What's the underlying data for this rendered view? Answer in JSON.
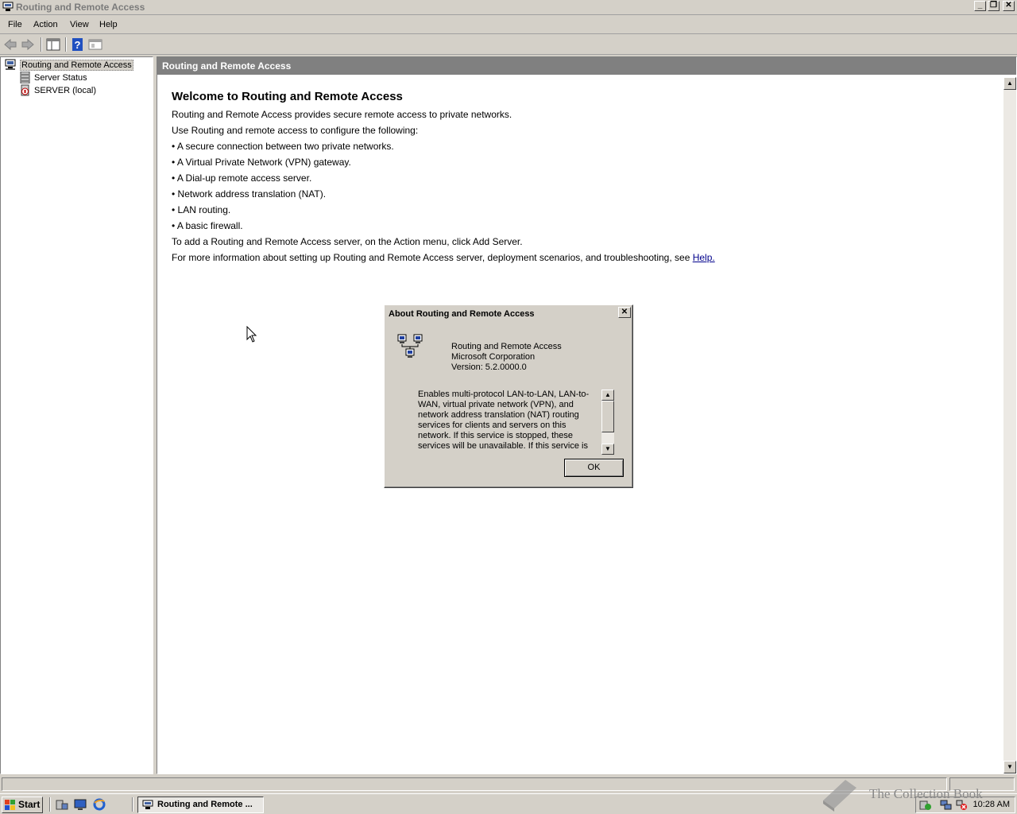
{
  "window": {
    "title": "Routing and Remote Access"
  },
  "menu": {
    "file": "File",
    "action": "Action",
    "view": "View",
    "help": "Help"
  },
  "tree": {
    "root": "Routing and Remote Access",
    "items": [
      {
        "label": "Server Status"
      },
      {
        "label": "SERVER (local)"
      }
    ]
  },
  "content": {
    "header": "Routing and Remote Access",
    "title": "Welcome to Routing and Remote Access",
    "lines": [
      "Routing and Remote Access provides secure remote access to private networks.",
      "Use Routing and remote access to configure the following:",
      "• A secure connection between two private networks.",
      "• A Virtual Private Network (VPN) gateway.",
      "• A Dial-up remote access server.",
      "• Network address translation (NAT).",
      "• LAN routing.",
      "• A basic firewall.",
      "To add a Routing and Remote Access server, on the Action menu, click Add Server."
    ],
    "more_info": "For more information about setting up Routing and Remote Access server, deployment scenarios, and troubleshooting, see ",
    "help_link": "Help."
  },
  "dialog": {
    "title": "About Routing and Remote Access",
    "product": "Routing and Remote Access",
    "company": "Microsoft Corporation",
    "version": "Version: 5.2.0000.0",
    "description": "Enables multi-protocol LAN-to-LAN, LAN-to-WAN, virtual private network (VPN), and network address translation (NAT) routing services for clients and servers on this network. If this service is stopped, these services will be unavailable. If this service is",
    "ok": "OK"
  },
  "taskbar": {
    "start": "Start",
    "task": "Routing and Remote ...",
    "clock": "10:28 AM"
  },
  "watermark": {
    "text": "The Collection Book"
  }
}
